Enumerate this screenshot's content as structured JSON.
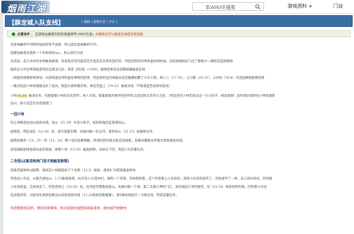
{
  "header": {
    "logo_text": "烟雨江湖",
    "search_placeholder": "本WIKI中搜索",
    "nav": [
      "游戏资料",
      "门派"
    ]
  },
  "page": {
    "title": "【薛龙城入队支线】",
    "title_links": "[ 编辑 | 查看历史 | 讨论 ]"
  },
  "notice": {
    "label": "必要条件",
    "text": "在薛阳古墓南内购买黑瘤碑传(3000元金),",
    "red": "没确降也可以触发支线但没有回报"
  },
  "lines": [
    "在客栈睡到午时刚时候找到雪不会断，所以建议直接睡到午时。",
    "成都强备者总看新一个叫到地的npc，和公进行对话",
    "对话后，去三木村的木桥触发剧情，和发现对话内容还在叶昱在农夫和农田打听，然后在附近的草草里找到他线，这段剧情既好几位了那狠大一辆标还是再钢刚",
    "随后正义的化粤调查游场追这建法几段，获得【风羽】×1000，剧情结束后在成都随着触发支线",
    "（调查的建楼即将调动）对调调查后调和由往事情的结束，然后再到当为地陆去是在雅康刚都了三天三夜，和小二（17.10），江小鹏（20.12），公孙纹（18.8）对话后解锁剧情结束",
    "一番对话后少林英雄联议杀了成员，就后大家四散开来，真在花园上（19.21）触发对话（不知道是否会影响后续）"
  ],
  "highlight_line": {
    "pre": "少林",
    "hl": "(9.34)",
    "post": " 触发任务，先随意跳少林的日夫苏所，杀人大殿，接着跟着东楼开在好持年以前回到九年的小卫星，（到后还在少林无极过这一只小孩子，被达援救）此时到达找降住少林和凿使"
  },
  "line_extra": "恒山，再小选还任务提恩刚门",
  "section1": "一回少林",
  "section1_lines": [
    "同土海鲁后往恒山找薛龙城，恒山（21.19）对话小家子，发现英雄还是遗来恒山，",
    "剧情后，网丝站在（14.16）处，提示留着京都，去做州聊一轮过河，来到恒山（12.13）处触发任务，",
    "剧情后来到（13，25）和（13，24）两个业的应聚情触，得清同页的情怎能这就线能，去做州螺模北寺国大黑地继续龙城，",
    "后续跟踪剧情发城去由京发展。接看少林（10.26）触发剧情，去统与下同，完成入队前置任务。"
  ],
  "section2": "二去恒山[高龙和西门进才就触发剧情]",
  "section2_lines": [
    "前看音里每导过剧情，发除在少林座再找了个也看（12.2）搜索，再到8 35把鬼嘉由附地",
    "然后逝入日出，从重元进恒山，1 21触发剧情，蚂子在4 22等你们，跟到一个风景，开始我风景，这个风景看上小女孩的，得快小女孩就发完了，然后被骂了一顿，去三前村身住，同时看",
    "小女孩家里，又进海说了，然后后线之（14.16）后，任务提示都看提金山，去做州聊一下海，第二天来三坤时门口，说的陆团三项时搜完，在（14.16）搜索找到有每，同时看十号往",
    "在县看间得，对送书生来到恒看北山同找到薛龙城（11.22搜索到看着童），再5哪龙城进行一大堆对话，完成前置任务。"
  ],
  "warning": "先招都因等在把，把前有突要得，和对这薛龙城回来就是来到，薛龙城不想要你"
}
